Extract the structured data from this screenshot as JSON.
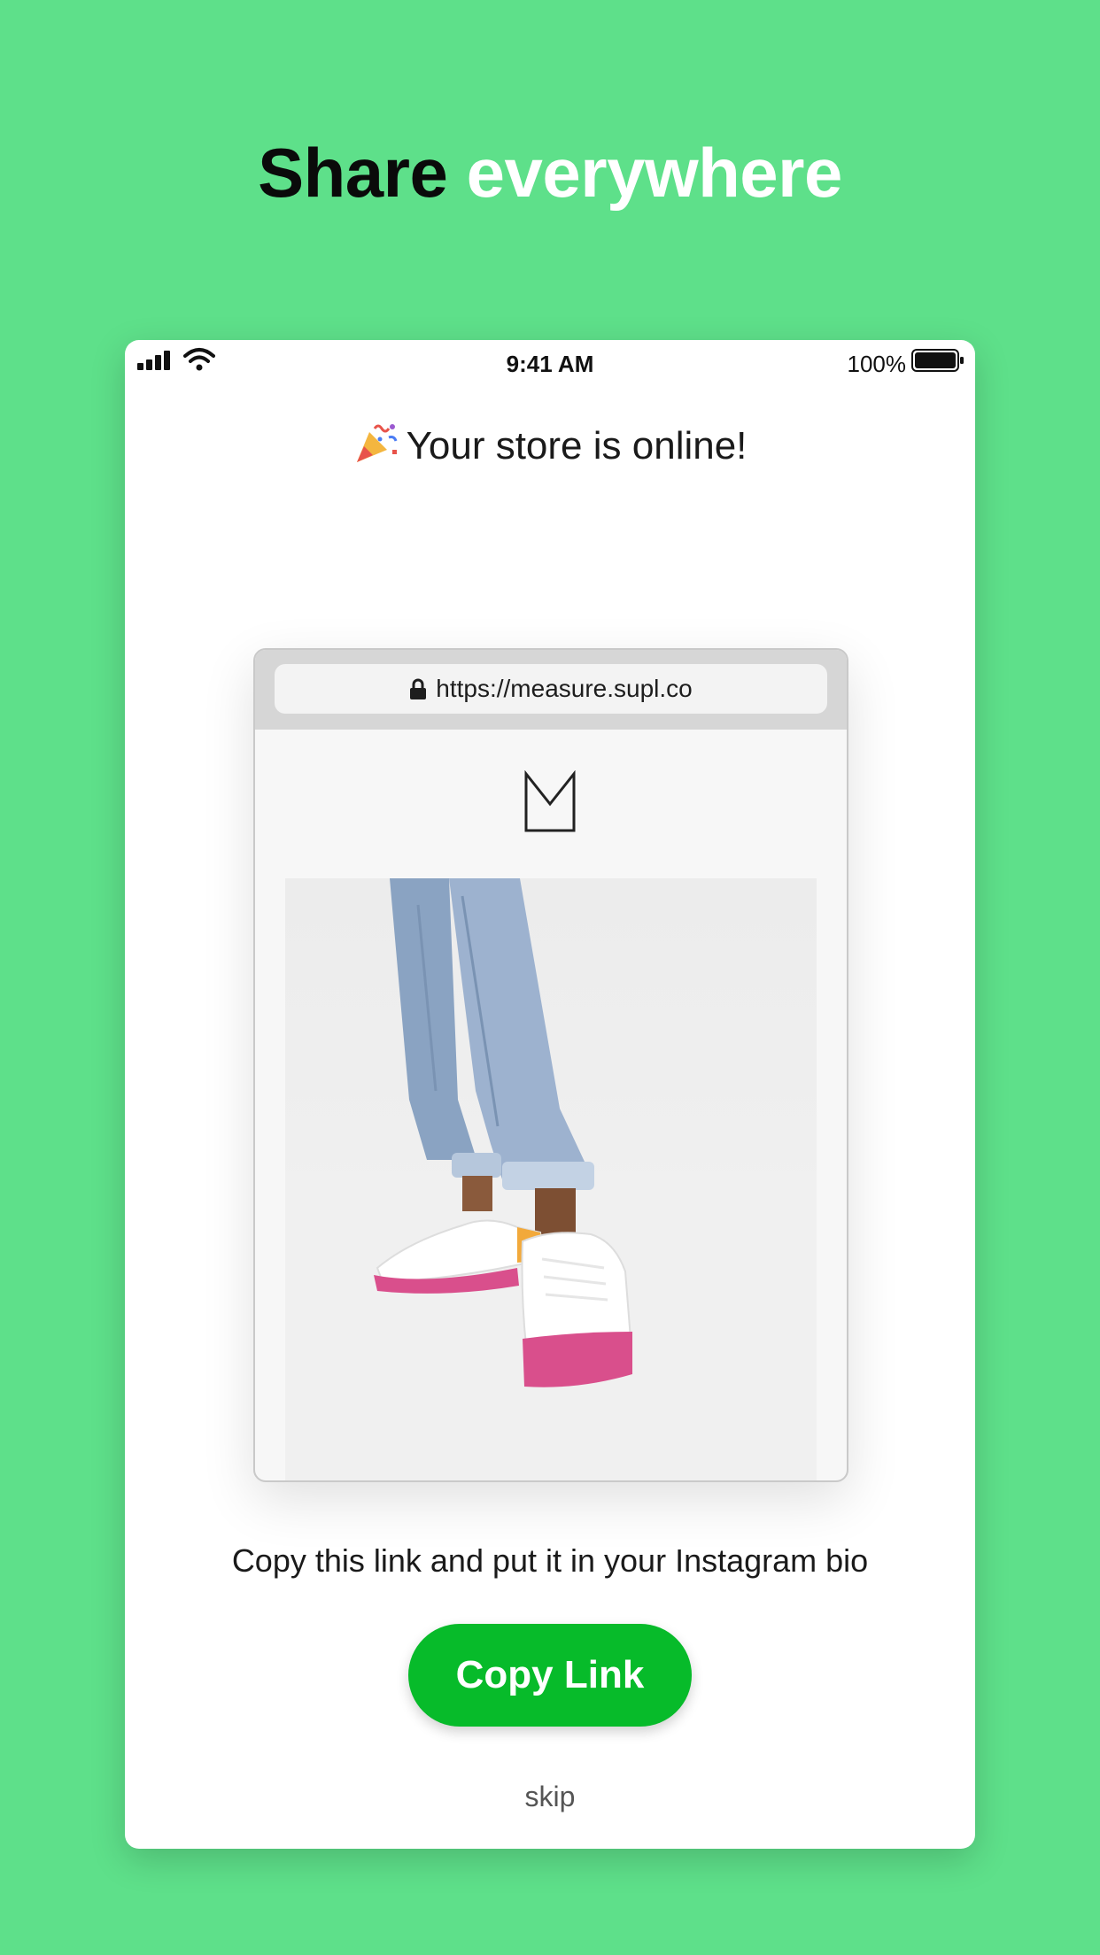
{
  "headline": {
    "dark": "Share",
    "light": "everywhere"
  },
  "status_bar": {
    "time": "9:41 AM",
    "battery": "100%"
  },
  "title": "Your store is online!",
  "browser": {
    "url": "https://measure.supl.co"
  },
  "instruction": "Copy this link and put it in your Instagram bio",
  "copy_button": "Copy Link",
  "skip": "skip",
  "colors": {
    "background": "#5ee08a",
    "button": "#07bb2a"
  },
  "icons": [
    "signal-icon",
    "wifi-icon",
    "battery-icon",
    "party-popper-icon",
    "lock-icon",
    "store-logo-icon"
  ]
}
